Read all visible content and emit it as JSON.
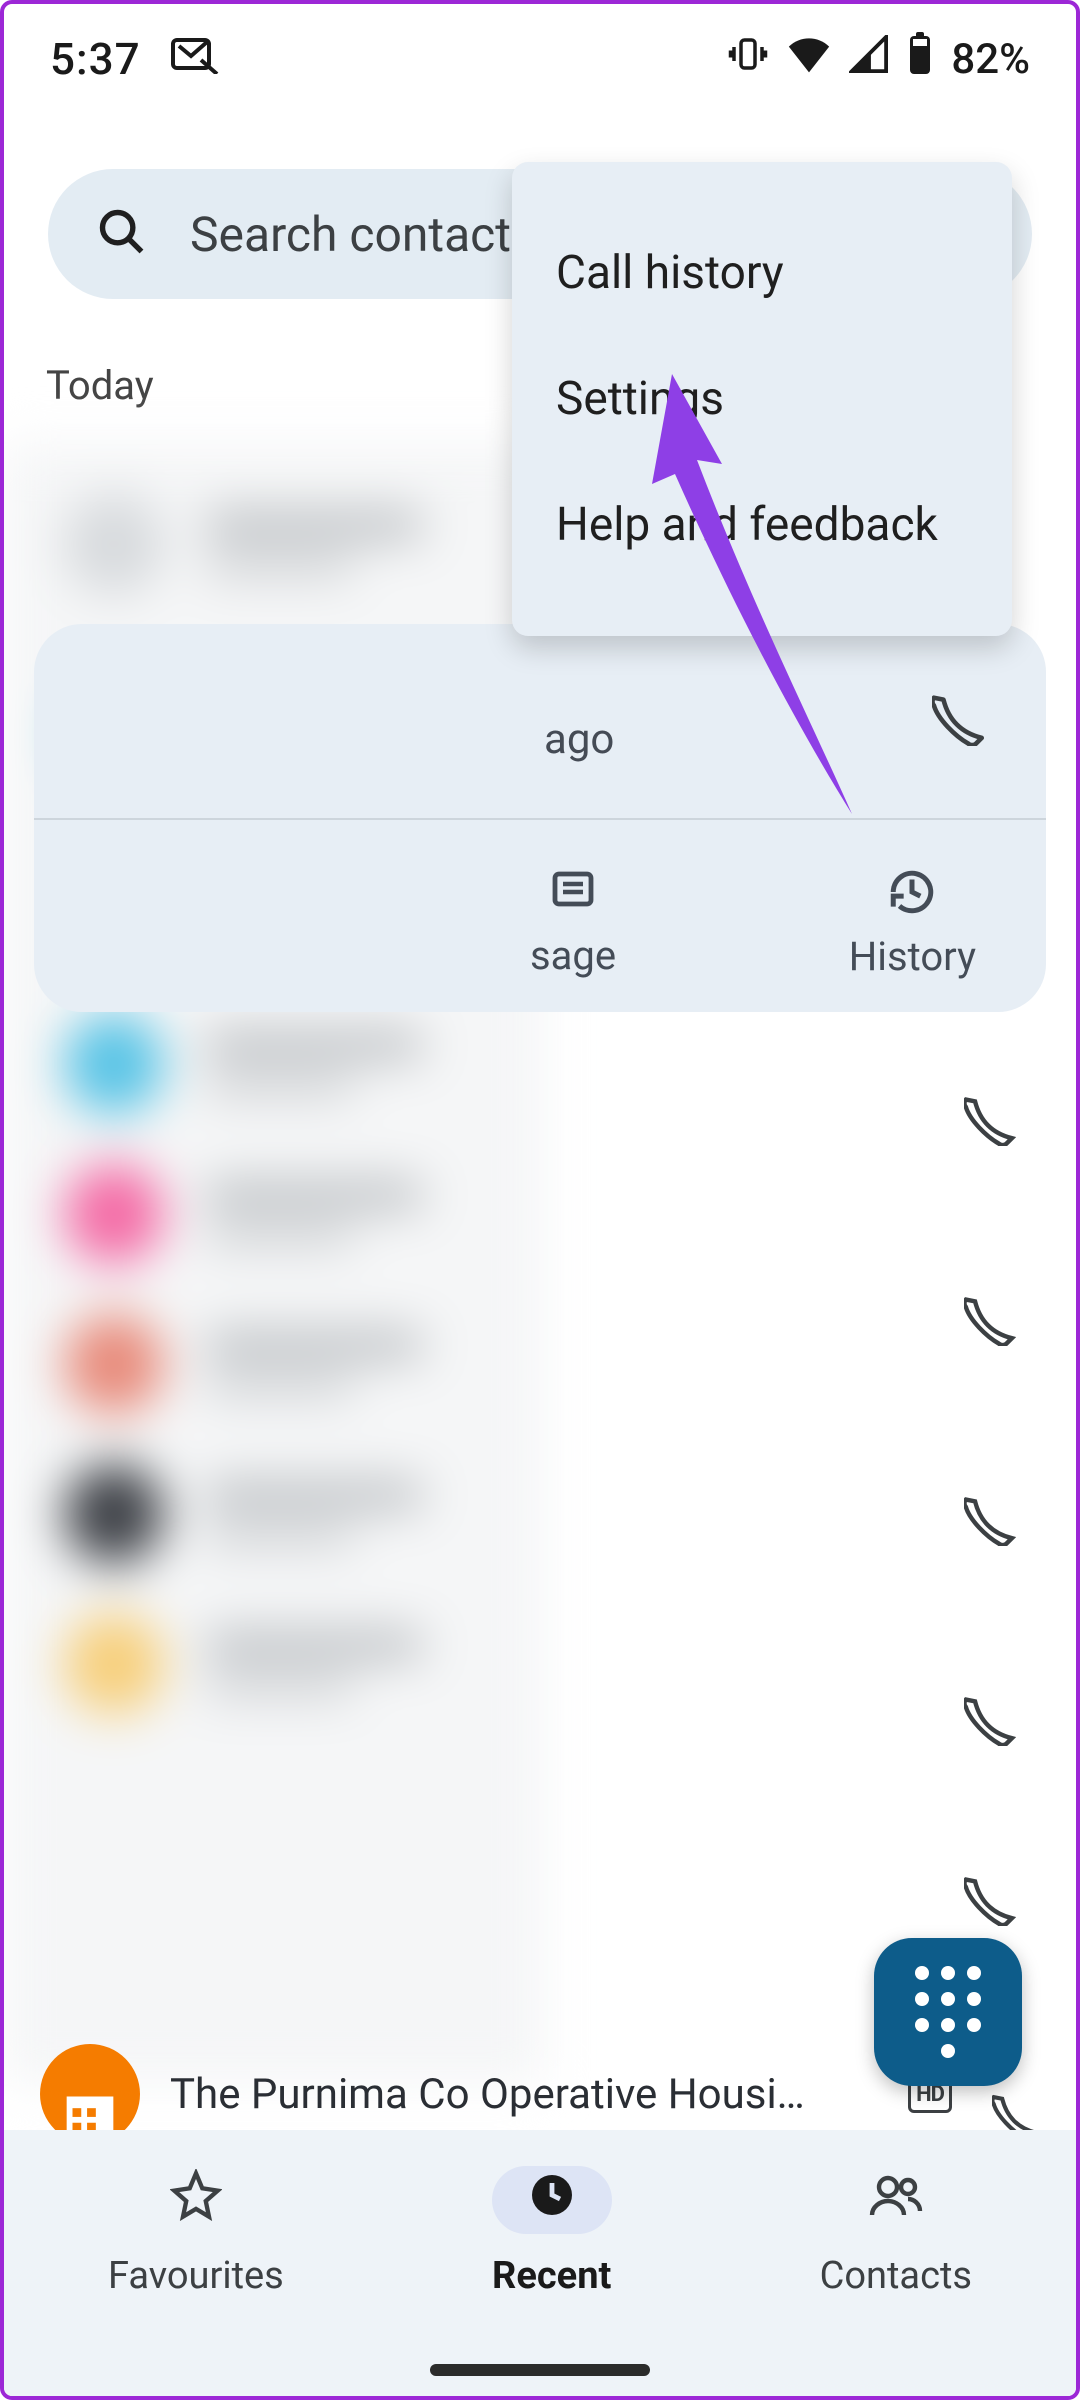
{
  "status": {
    "time": "5:37",
    "battery_pct": "82%"
  },
  "search": {
    "placeholder": "Search contacts a"
  },
  "menu": {
    "items": [
      "Call history",
      "Settings",
      "Help and feedback"
    ]
  },
  "section_header": "Today",
  "expanded_card": {
    "time_suffix": "ago",
    "action_message": "sage",
    "action_history": "History"
  },
  "visible_contact": {
    "name": "The Purnima Co Operative Housi…",
    "hd": "HD"
  },
  "bottom_nav": {
    "favourites": "Favourites",
    "recent": "Recent",
    "contacts": "Contacts",
    "active": "recent"
  }
}
